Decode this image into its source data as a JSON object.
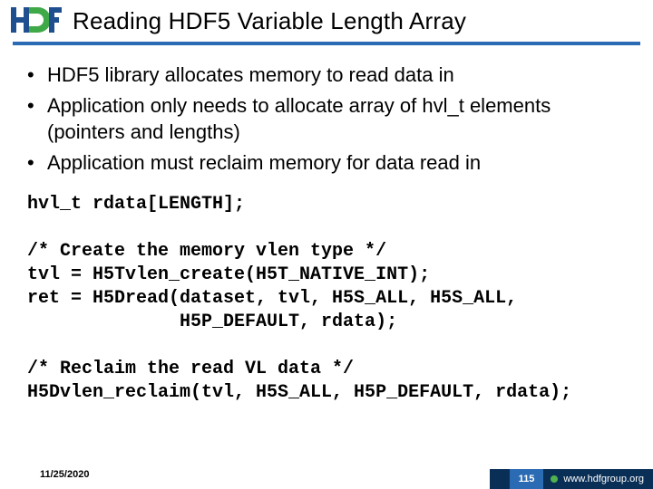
{
  "header": {
    "title": "Reading HDF5 Variable Length Array"
  },
  "bullets": [
    "HDF5 library allocates memory to read data in",
    "Application only needs to allocate array of hvl_t elements (pointers and lengths)",
    "Application must reclaim memory for data read in"
  ],
  "code": "hvl_t rdata[LENGTH];\n\n/* Create the memory vlen type */\ntvl = H5Tvlen_create(H5T_NATIVE_INT);\nret = H5Dread(dataset, tvl, H5S_ALL, H5S_ALL,\n              H5P_DEFAULT, rdata);\n\n/* Reclaim the read VL data */\nH5Dvlen_reclaim(tvl, H5S_ALL, H5P_DEFAULT, rdata);",
  "footer": {
    "date": "11/25/2020",
    "page": "115",
    "url": "www.hdfgroup.org"
  }
}
